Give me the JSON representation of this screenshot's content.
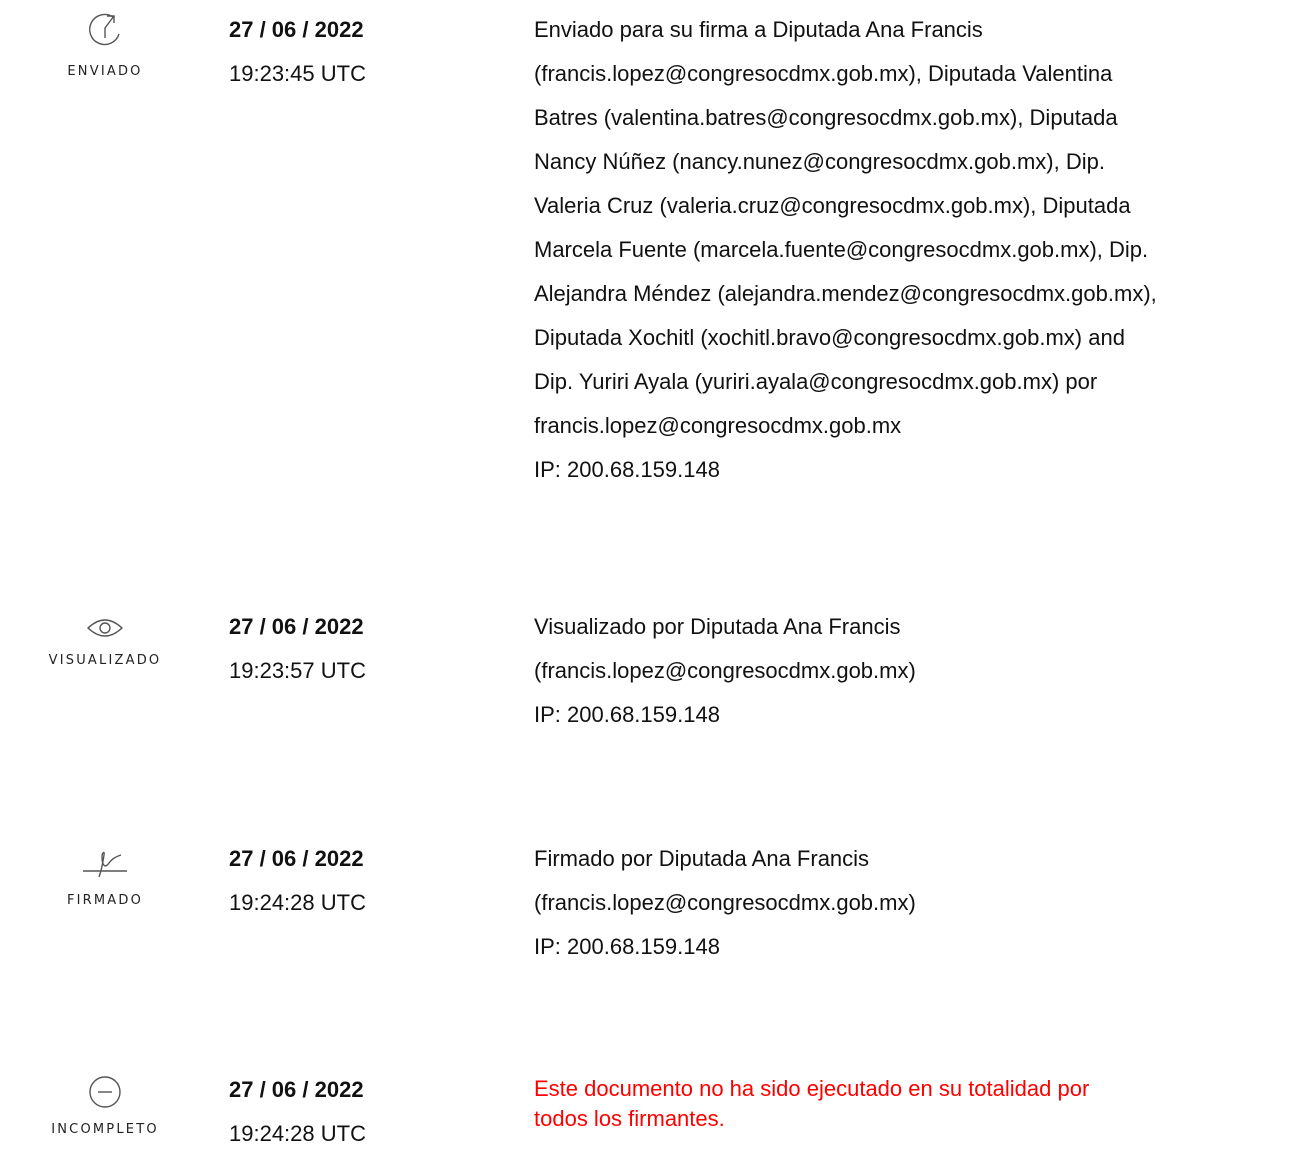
{
  "events": [
    {
      "status": "ENVIADO",
      "icon": "forward-arrow-icon",
      "date": "27 / 06 / 2022",
      "time": "19:23:45 UTC",
      "description_lines": [
        "Enviado para su firma a Diputada Ana Francis",
        "(francis.lopez@congresocdmx.gob.mx), Diputada Valentina",
        "Batres (valentina.batres@congresocdmx.gob.mx), Diputada",
        "Nancy Núñez (nancy.nunez@congresocdmx.gob.mx), Dip.",
        "Valeria Cruz (valeria.cruz@congresocdmx.gob.mx), Diputada",
        "Marcela Fuente (marcela.fuente@congresocdmx.gob.mx), Dip.",
        "Alejandra Méndez (alejandra.mendez@congresocdmx.gob.mx),",
        "Diputada Xochitl (xochitl.bravo@congresocdmx.gob.mx) and",
        "Dip. Yuriri Ayala (yuriri.ayala@congresocdmx.gob.mx) por",
        "francis.lopez@congresocdmx.gob.mx",
        "IP: 200.68.159.148"
      ]
    },
    {
      "status": "VISUALIZADO",
      "icon": "eye-icon",
      "date": "27 / 06 / 2022",
      "time": "19:23:57 UTC",
      "description_lines": [
        "Visualizado por Diputada Ana Francis",
        "(francis.lopez@congresocdmx.gob.mx)",
        "IP: 200.68.159.148"
      ]
    },
    {
      "status": "FIRMADO",
      "icon": "signature-icon",
      "date": "27 / 06 / 2022",
      "time": "19:24:28 UTC",
      "description_lines": [
        "Firmado por Diputada Ana Francis",
        "(francis.lopez@congresocdmx.gob.mx)",
        "IP: 200.68.159.148"
      ]
    },
    {
      "status": "INCOMPLETO",
      "icon": "minus-circle-icon",
      "date": "27 / 06 / 2022",
      "time": "19:24:28 UTC",
      "description_lines": [
        "Este documento no ha sido ejecutado en su totalidad por",
        "todos los firmantes."
      ],
      "alert_color": "#ff0000"
    }
  ]
}
